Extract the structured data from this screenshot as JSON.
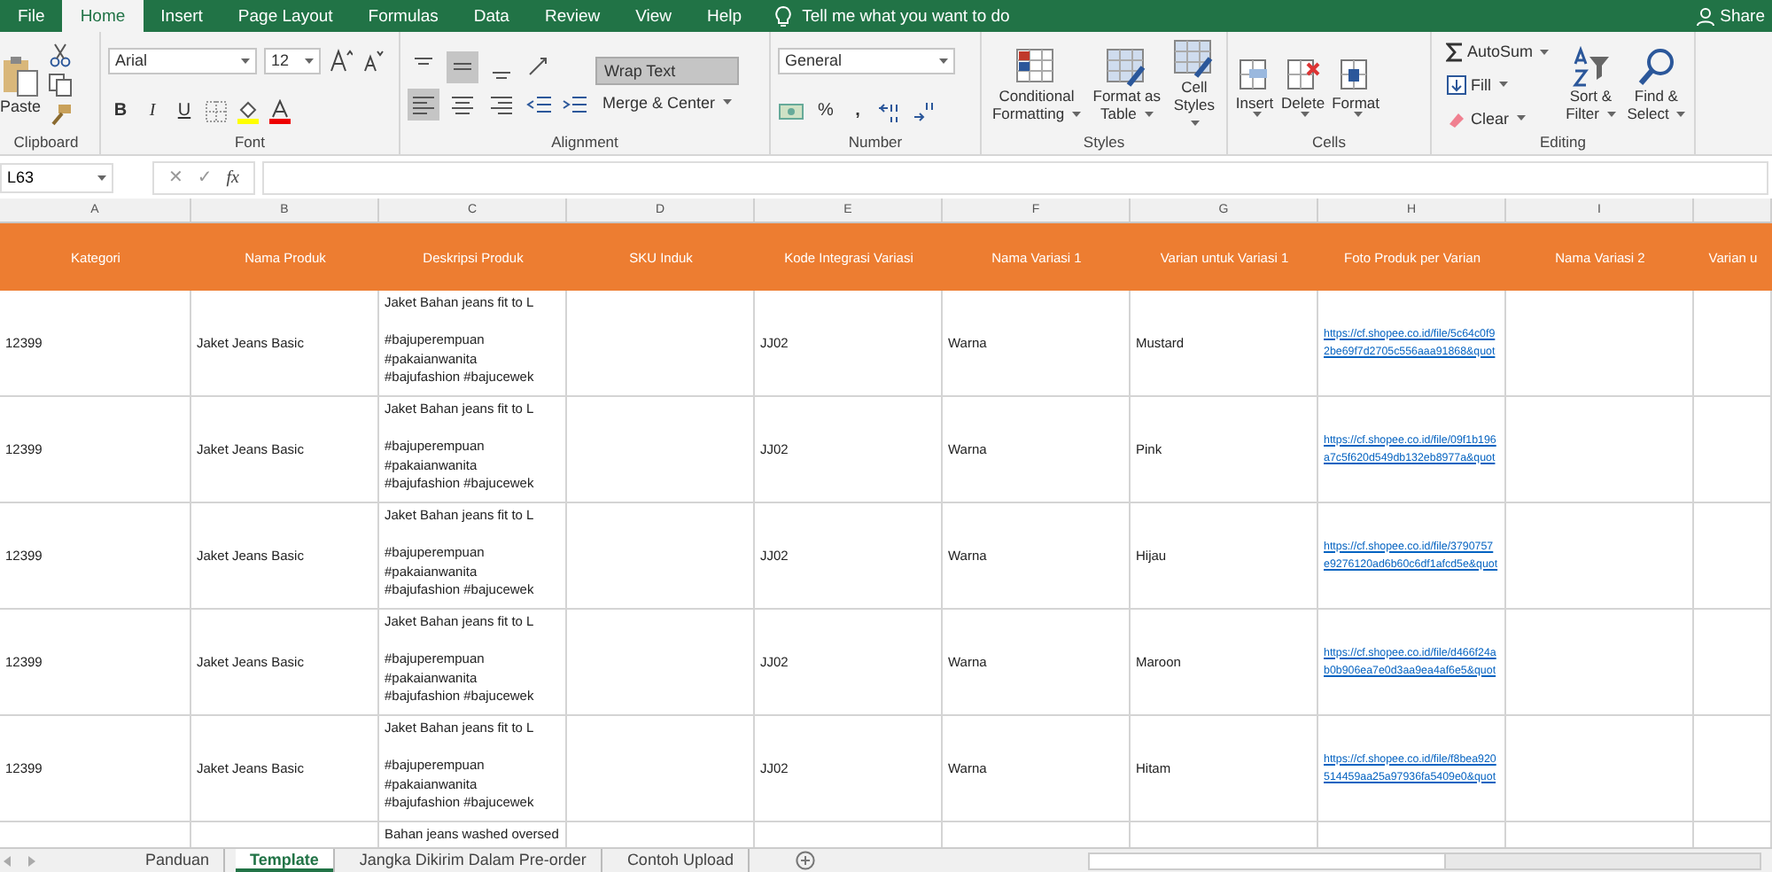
{
  "menu_tabs": [
    {
      "label": "File",
      "selected": false
    },
    {
      "label": "Home",
      "selected": true
    },
    {
      "label": "Insert",
      "selected": false
    },
    {
      "label": "Page Layout",
      "selected": false
    },
    {
      "label": "Formulas",
      "selected": false
    },
    {
      "label": "Data",
      "selected": false
    },
    {
      "label": "Review",
      "selected": false
    },
    {
      "label": "View",
      "selected": false
    },
    {
      "label": "Help",
      "selected": false
    }
  ],
  "tell_me": "Tell me what you want to do",
  "share": "Share",
  "ribbon": {
    "clipboard": {
      "label": "Clipboard",
      "paste": "Paste"
    },
    "font": {
      "label": "Font",
      "family": "Arial",
      "size": "12",
      "bold": "B",
      "italic": "I",
      "underline": "U"
    },
    "alignment": {
      "label": "Alignment",
      "vertical": [
        {
          "selected": false
        },
        {
          "selected": true
        },
        {
          "selected": false
        }
      ],
      "horizontal": [
        {
          "selected": true
        },
        {
          "selected": false
        },
        {
          "selected": false
        }
      ],
      "wrap_text": {
        "label": "Wrap Text",
        "selected": true
      },
      "merge": "Merge & Center"
    },
    "number": {
      "label": "Number",
      "format": "General",
      "percent": "%",
      "comma": ","
    },
    "styles": {
      "label": "Styles",
      "buttons": [
        "Conditional Formatting",
        "Format as Table",
        "Cell Styles"
      ]
    },
    "cells": {
      "label": "Cells",
      "buttons": [
        "Insert",
        "Delete",
        "Format"
      ]
    },
    "editing": {
      "label": "Editing",
      "autosum": "AutoSum",
      "fill": "Fill",
      "clear": "Clear",
      "sort": "Sort & Filter",
      "find": "Find & Select"
    }
  },
  "formula_bar": {
    "name_box": "L63",
    "cancel": "✕",
    "enter": "✓",
    "fx": "fx"
  },
  "columns": [
    {
      "letter": "A",
      "header": "Kategori",
      "kind": "text"
    },
    {
      "letter": "B",
      "header": "Nama Produk",
      "kind": "text"
    },
    {
      "letter": "C",
      "header": "Deskripsi Produk",
      "kind": "para"
    },
    {
      "letter": "D",
      "header": "SKU Induk",
      "kind": "text"
    },
    {
      "letter": "E",
      "header": "Kode Integrasi Variasi",
      "kind": "text"
    },
    {
      "letter": "F",
      "header": "Nama Variasi 1",
      "kind": "text"
    },
    {
      "letter": "G",
      "header": "Varian untuk Variasi 1",
      "kind": "text"
    },
    {
      "letter": "H",
      "header": "Foto Produk per Varian",
      "kind": "link"
    },
    {
      "letter": "I",
      "header": "Nama Variasi 2",
      "kind": "text"
    },
    {
      "header": "Varian u",
      "kind": "text"
    }
  ],
  "rows": [
    {
      "A": "12399",
      "B": "Jaket Jeans Basic",
      "C": "Jaket Bahan jeans fit to L\n\n#bajuperempuan\n#pakaianwanita\n#bajufashion #bajucewek",
      "E": "JJ02",
      "F": "Warna",
      "G": "Mustard",
      "H": "https://cf.shopee.co.id/file/5c64c0f92be69f7d2705c556aaa91868&quot"
    },
    {
      "A": "12399",
      "B": "Jaket Jeans Basic",
      "C": "Jaket Bahan jeans fit to L\n\n#bajuperempuan\n#pakaianwanita\n#bajufashion #bajucewek",
      "E": "JJ02",
      "F": "Warna",
      "G": "Pink",
      "H": "https://cf.shopee.co.id/file/09f1b196a7c5f620d549db132eb8977a&quot"
    },
    {
      "A": "12399",
      "B": "Jaket Jeans Basic",
      "C": "Jaket Bahan jeans fit to L\n\n#bajuperempuan\n#pakaianwanita\n#bajufashion #bajucewek",
      "E": "JJ02",
      "F": "Warna",
      "G": "Hijau",
      "H": "https://cf.shopee.co.id/file/3790757e9276120ad6b60c6df1afcd5e&quot"
    },
    {
      "A": "12399",
      "B": "Jaket Jeans Basic",
      "C": "Jaket Bahan jeans fit to L\n\n#bajuperempuan\n#pakaianwanita\n#bajufashion #bajucewek",
      "E": "JJ02",
      "F": "Warna",
      "G": "Maroon",
      "H": "https://cf.shopee.co.id/file/d466f24ab0b906ea7e0d3aa9ea4af6e5&quot"
    },
    {
      "A": "12399",
      "B": "Jaket Jeans Basic",
      "C": "Jaket Bahan jeans fit to L\n\n#bajuperempuan\n#pakaianwanita\n#bajufashion #bajucewek",
      "E": "JJ02",
      "F": "Warna",
      "G": "Hitam",
      "H": "https://cf.shopee.co.id/file/f8bea920514459aa25a97936fa5409e0&quot"
    }
  ],
  "partial_row": {
    "C": "Bahan jeans washed oversed"
  },
  "sheet_tabs": [
    {
      "label": "Panduan",
      "selected": false
    },
    {
      "label": "Template",
      "selected": true
    },
    {
      "label": "Jangka Dikirim Dalam Pre-order",
      "selected": false
    },
    {
      "label": "Contoh Upload",
      "selected": false
    }
  ]
}
